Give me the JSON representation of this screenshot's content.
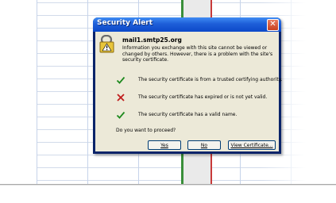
{
  "dialog": {
    "title": "Security Alert",
    "host": "mail1.smtp25.org",
    "info_text": "Information you exchange with this site cannot be viewed or changed by others. However, there is a problem with the site's security certificate.",
    "items": [
      {
        "status": "ok",
        "icon": "check-icon",
        "text": "The security certificate is from a trusted certifying authority."
      },
      {
        "status": "error",
        "icon": "x-icon",
        "text": "The security certificate has expired or is not yet valid."
      },
      {
        "status": "ok",
        "icon": "check-icon",
        "text": "The security certificate has a valid name."
      }
    ],
    "question": "Do you want to proceed?",
    "buttons": {
      "yes": "Yes",
      "no": "No",
      "view": "View Certificate..."
    },
    "close_glyph": "✕"
  },
  "colors": {
    "check": "#1f8a1f",
    "cross": "#c01c1c",
    "title_bar": "#1e5ed8",
    "dialog_bg": "#ece9d8"
  }
}
